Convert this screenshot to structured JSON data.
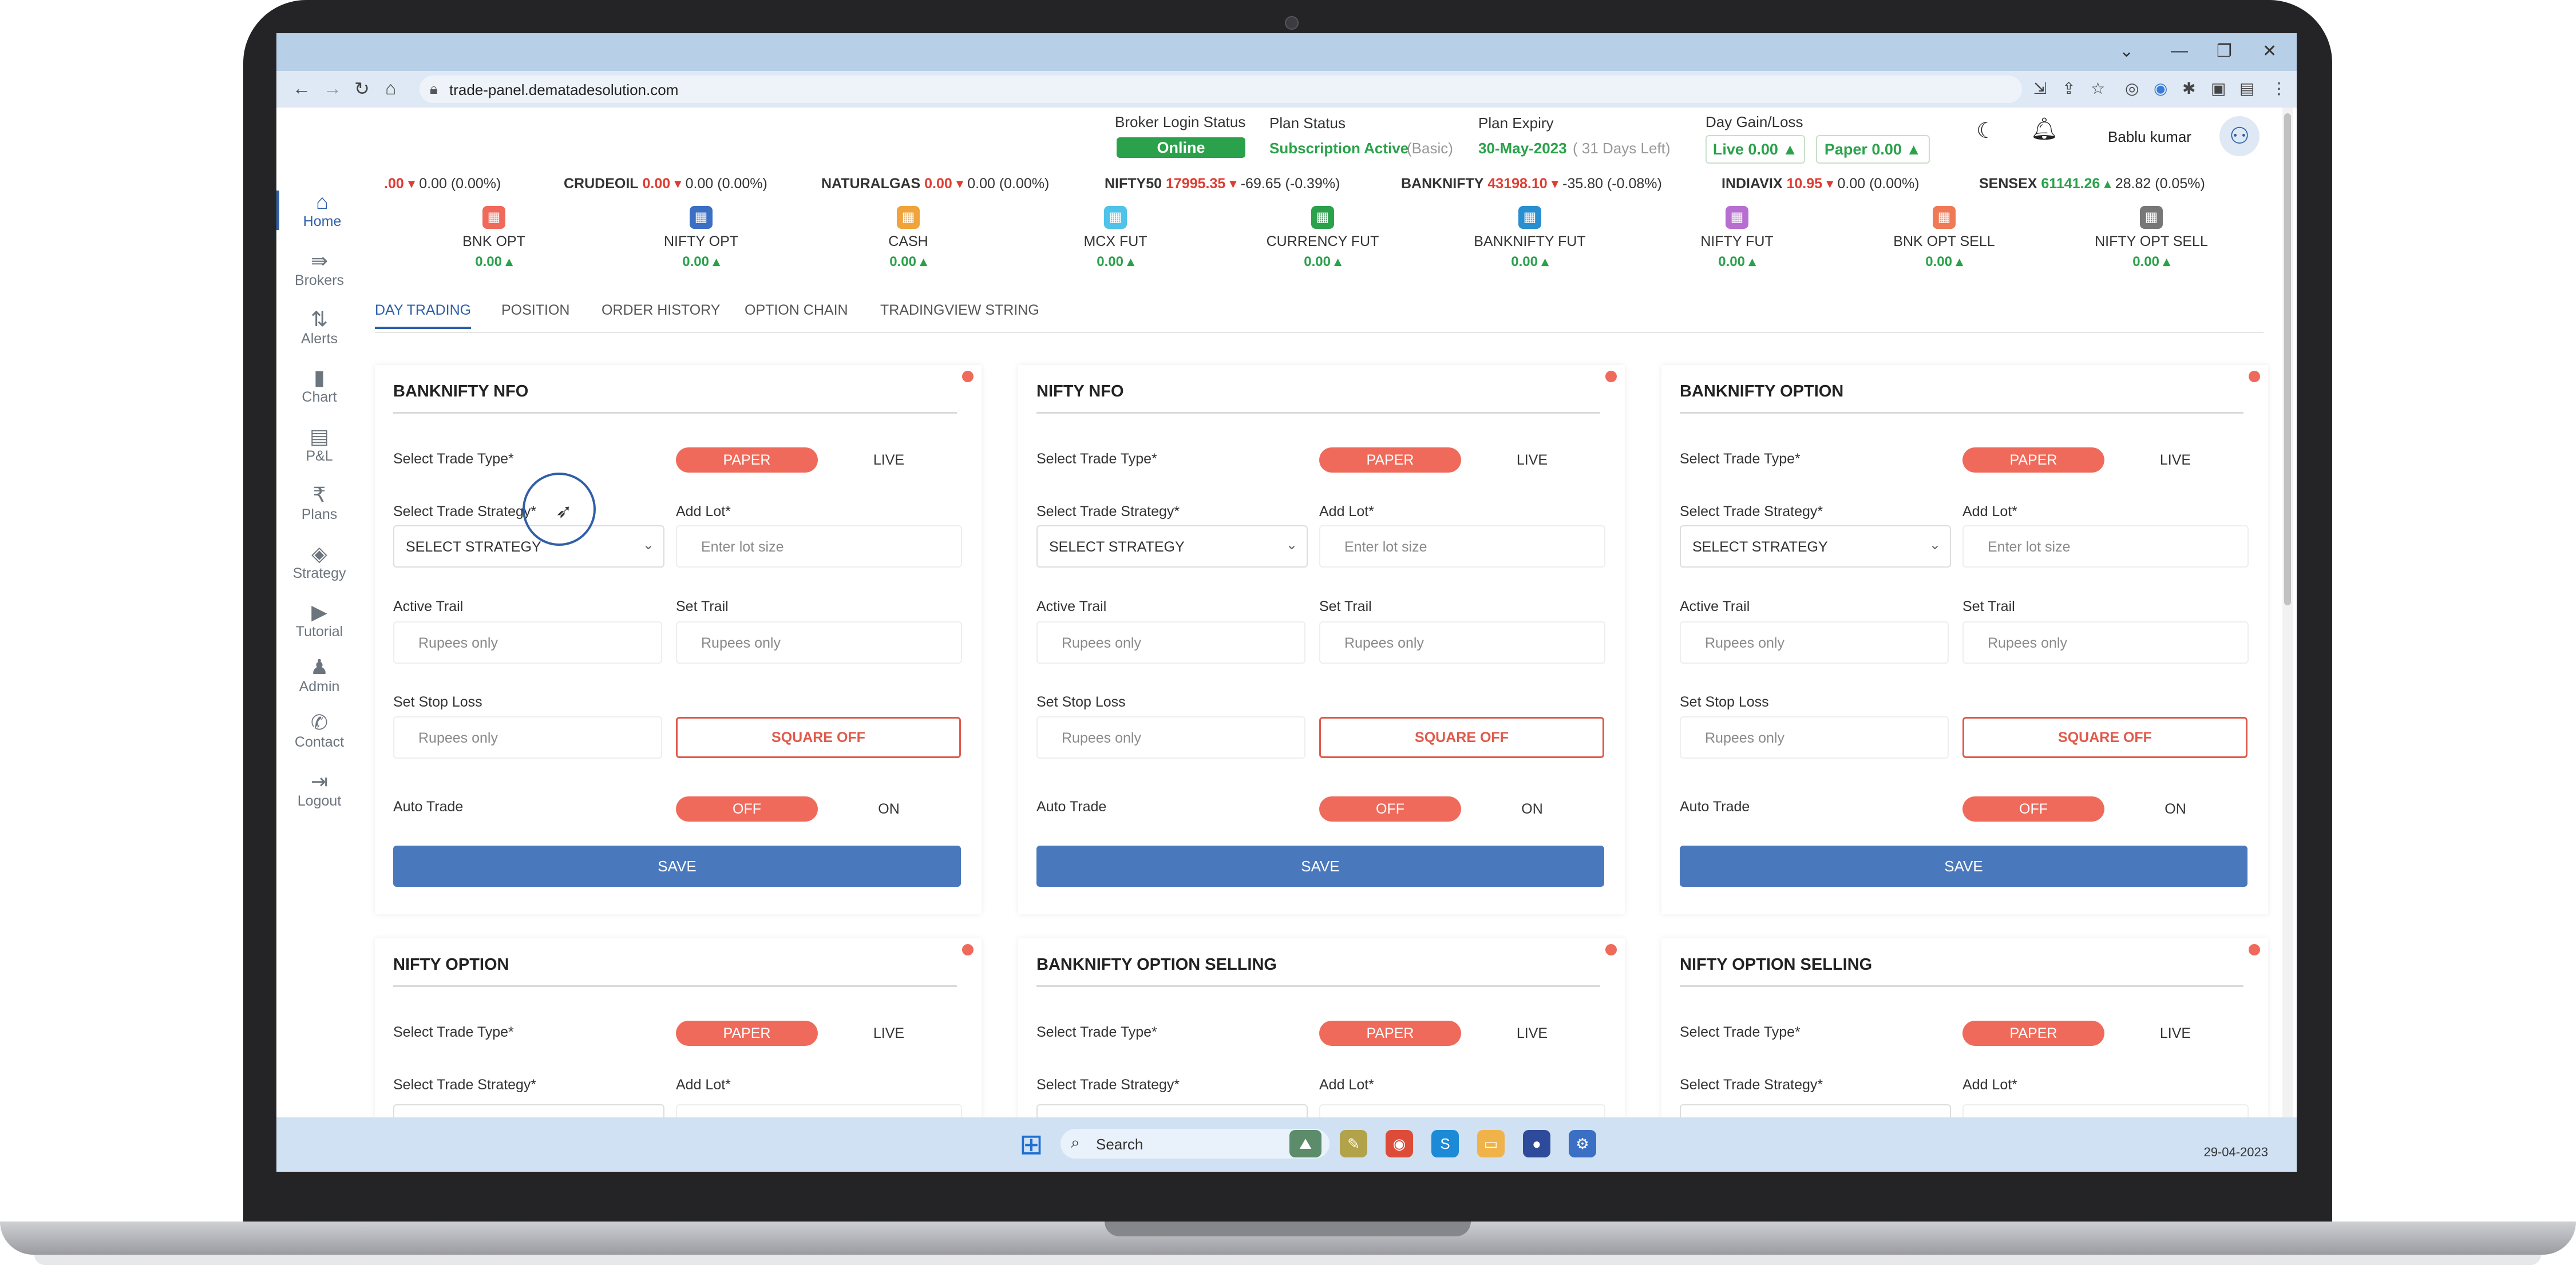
{
  "browser": {
    "url": "trade-panel.dematadesolution.com"
  },
  "header": {
    "broker_login_label": "Broker Login Status",
    "broker_status": "Online",
    "plan_status_label": "Plan Status",
    "plan_status_value": "Subscription Active",
    "plan_type": "(Basic)",
    "plan_expiry_label": "Plan Expiry",
    "plan_expiry_value": "30-May-2023",
    "plan_days_left": "( 31 Days Left)",
    "day_gain_label": "Day Gain/Loss",
    "live_gain": "Live 0.00",
    "paper_gain": "Paper 0.00",
    "user_name": "Bablu kumar"
  },
  "sidebar": {
    "items": [
      {
        "label": "Home",
        "icon": "home-icon"
      },
      {
        "label": "Brokers",
        "icon": "brokers-icon"
      },
      {
        "label": "Alerts",
        "icon": "alerts-icon"
      },
      {
        "label": "Chart",
        "icon": "chart-icon"
      },
      {
        "label": "P&L",
        "icon": "pnl-icon"
      },
      {
        "label": "Plans",
        "icon": "rupee-icon"
      },
      {
        "label": "Strategy",
        "icon": "strategy-icon"
      },
      {
        "label": "Tutorial",
        "icon": "play-icon"
      },
      {
        "label": "Admin",
        "icon": "admin-icon"
      },
      {
        "label": "Contact",
        "icon": "phone-icon"
      },
      {
        "label": "Logout",
        "icon": "logout-icon"
      }
    ]
  },
  "ticker": [
    {
      "name": "",
      "price": ".00",
      "change": "0.00 (0.00%)"
    },
    {
      "name": "CRUDEOIL",
      "price": "0.00",
      "change": "0.00 (0.00%)"
    },
    {
      "name": "NATURALGAS",
      "price": "0.00",
      "change": "0.00 (0.00%)"
    },
    {
      "name": "NIFTY50",
      "price": "17995.35",
      "change": "-69.65 (-0.39%)"
    },
    {
      "name": "BANKNIFTY",
      "price": "43198.10",
      "change": "-35.80 (-0.08%)"
    },
    {
      "name": "INDIAVIX",
      "price": "10.95",
      "change": "0.00 (0.00%)"
    },
    {
      "name": "SENSEX",
      "price": "61141.26",
      "change": "28.82 (0.05%)"
    }
  ],
  "segments": [
    {
      "name": "BNK OPT",
      "value": "0.00",
      "color": "#ef6a5a"
    },
    {
      "name": "NIFTY OPT",
      "value": "0.00",
      "color": "#3a6fc4"
    },
    {
      "name": "CASH",
      "value": "0.00",
      "color": "#f0a33a"
    },
    {
      "name": "MCX FUT",
      "value": "0.00",
      "color": "#4fc3e8"
    },
    {
      "name": "CURRENCY FUT",
      "value": "0.00",
      "color": "#2aa14a"
    },
    {
      "name": "BANKNIFTY FUT",
      "value": "0.00",
      "color": "#2a8fd0"
    },
    {
      "name": "NIFTY FUT",
      "value": "0.00",
      "color": "#b66fd0"
    },
    {
      "name": "BNK OPT SELL",
      "value": "0.00",
      "color": "#ef7a55"
    },
    {
      "name": "NIFTY OPT SELL",
      "value": "0.00",
      "color": "#777777"
    }
  ],
  "tabs": [
    "DAY TRADING",
    "POSITION",
    "ORDER HISTORY",
    "OPTION CHAIN",
    "TRADINGVIEW STRING"
  ],
  "form": {
    "trade_type_label": "Select Trade Type*",
    "paper": "PAPER",
    "live": "LIVE",
    "strategy_label": "Select Trade Strategy*",
    "strategy_placeholder": "SELECT STRATEGY",
    "add_lot_label": "Add Lot*",
    "add_lot_placeholder": "Enter lot size",
    "active_trail_label": "Active Trail",
    "set_trail_label": "Set Trail",
    "stop_loss_label": "Set Stop Loss",
    "rupees_placeholder": "Rupees only",
    "square_off": "SQUARE OFF",
    "auto_trade_label": "Auto Trade",
    "off": "OFF",
    "on": "ON",
    "save": "SAVE"
  },
  "cards": [
    {
      "title": "BANKNIFTY NFO"
    },
    {
      "title": "NIFTY NFO"
    },
    {
      "title": "BANKNIFTY OPTION"
    },
    {
      "title": "NIFTY OPTION"
    },
    {
      "title": "BANKNIFTY OPTION SELLING"
    },
    {
      "title": "NIFTY OPTION SELLING"
    }
  ],
  "taskbar": {
    "search": "Search",
    "date": "29-04-2023"
  }
}
